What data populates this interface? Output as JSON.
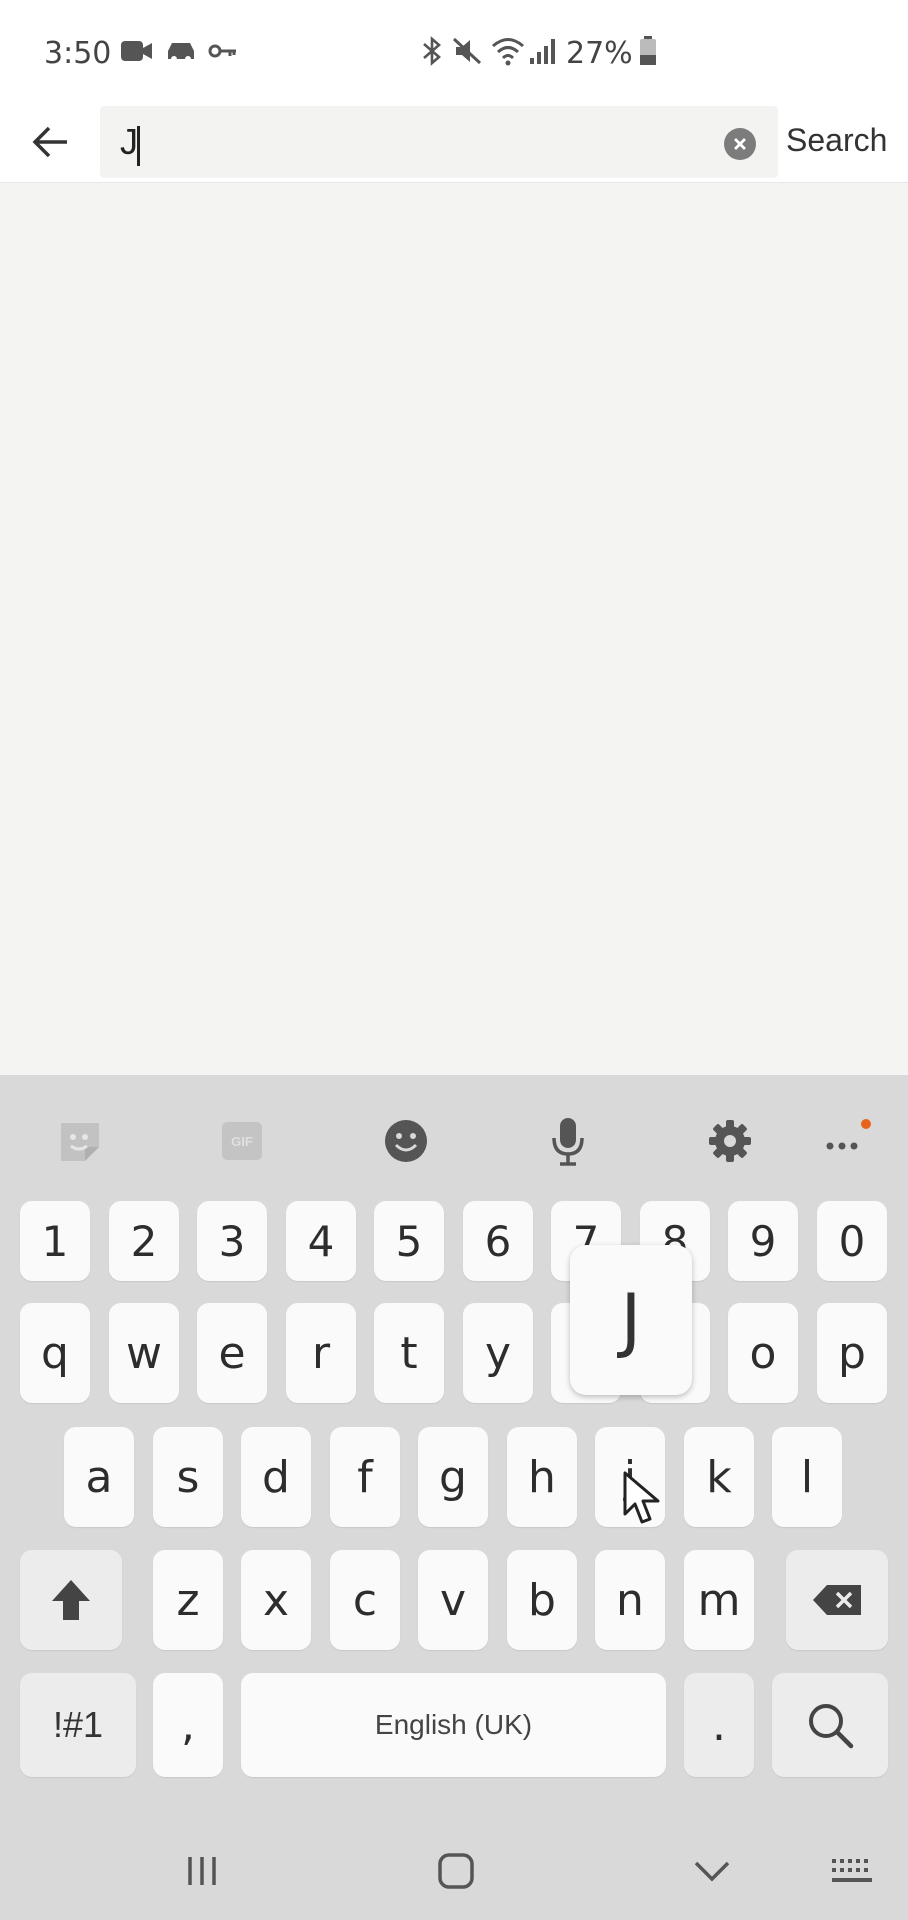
{
  "status": {
    "time": "3:50",
    "battery": "27%",
    "icons": [
      "video-call-icon",
      "car-icon",
      "key-icon",
      "bluetooth-icon",
      "mute-icon",
      "wifi-icon",
      "signal-icon",
      "battery-icon"
    ]
  },
  "search": {
    "value": "J",
    "action_label": "Search"
  },
  "keyboard": {
    "toolbar": [
      "sticker-icon",
      "gif-icon",
      "emoji-icon",
      "microphone-icon",
      "settings-icon",
      "more-icon"
    ],
    "gif_label": "GIF",
    "number_row": [
      "1",
      "2",
      "3",
      "4",
      "5",
      "6",
      "7",
      "8",
      "9",
      "0"
    ],
    "row1": [
      "q",
      "w",
      "e",
      "r",
      "t",
      "y",
      "u",
      "i",
      "o",
      "p"
    ],
    "row2": [
      "a",
      "s",
      "d",
      "f",
      "g",
      "h",
      "j",
      "k",
      "l"
    ],
    "row3": [
      "z",
      "x",
      "c",
      "v",
      "b",
      "n",
      "m"
    ],
    "symbols_label": "!#1",
    "comma": ",",
    "space_label": "English (UK)",
    "period": ".",
    "preview_char": "J"
  },
  "colors": {
    "keyboard_bg": "#d9d9d9",
    "key_bg": "#fafafa",
    "page_bg": "#f4f5f3",
    "notification_dot": "#e8641c"
  }
}
